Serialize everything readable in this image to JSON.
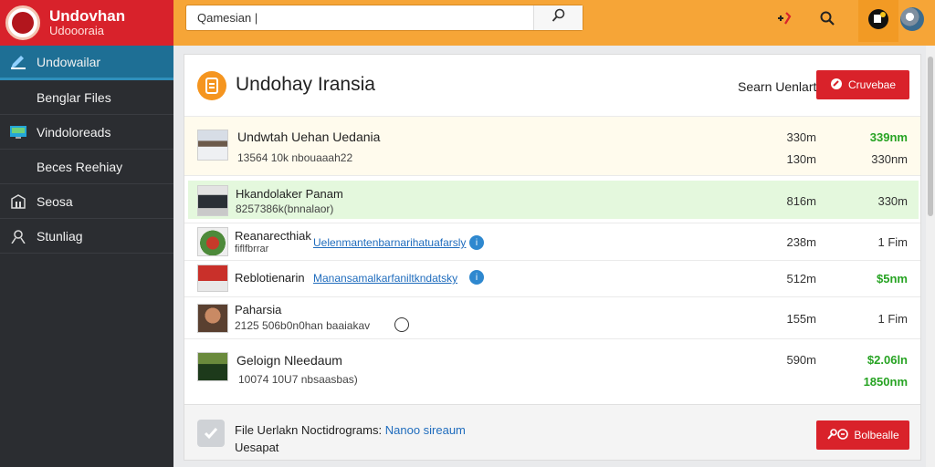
{
  "app": {
    "title": "Undovhan",
    "subtitle": "Udoooraia"
  },
  "sidebar": {
    "items": [
      {
        "label": "Undowailar",
        "icon": "edit-icon",
        "active": true
      },
      {
        "label": "Benglar Files",
        "icon": "",
        "active": false
      },
      {
        "label": "Vindoloreads",
        "icon": "monitor-icon",
        "active": false
      },
      {
        "label": "Beces Reehiay",
        "icon": "",
        "active": false
      },
      {
        "label": "Seosa",
        "icon": "building-icon",
        "active": false
      },
      {
        "label": "Stunliag",
        "icon": "user-icon",
        "active": false
      }
    ]
  },
  "topbar": {
    "search_value": "Qamesian |"
  },
  "header": {
    "title": "Undohay Iransia",
    "link": "Searn Uenlart",
    "button": "Cruvebae"
  },
  "rows": [
    {
      "title": "Undwtah Uehan Uedania",
      "sub": "13564 10k nbouaaah22",
      "col1_top": "330m",
      "col1_bot": "130m",
      "col2_top": "339nm",
      "col2_bot": "330nm"
    },
    {
      "title": "Hkandolaker Panam",
      "sub": "8257386k(bnnalaor)",
      "col1": "816m",
      "col2": "330m"
    },
    {
      "title": "Reanarecthiak",
      "sub": "fiflfbrrar",
      "link": "Uelenmantenbarnarihatuafarsly",
      "col1": "238m",
      "col2": "1 Fim"
    },
    {
      "title": "Reblotienarin",
      "link": "Manansamalkarfaniltkndatsky",
      "col1": "512m",
      "col2": "$5nm"
    },
    {
      "title": "Paharsia",
      "sub": "2125 506b0n0han baaiakav",
      "col1": "155m",
      "col2": "1 Fim"
    },
    {
      "title": "Geloign Nleedaum",
      "sub": "10074 10U7 nbsaasbas)",
      "col1": "590m",
      "col2_top": "$2.06ln",
      "col2_bot": "1850nm"
    }
  ],
  "footer": {
    "text": "File Uerlakn Noctidrograms:",
    "link": "Nanoo sireaum",
    "sub": "Uesapat",
    "button": "Bolbealle"
  },
  "colors": {
    "brand_red": "#d8222b",
    "topbar_orange": "#f6a537",
    "sidebar_dark": "#2b2d31",
    "active_blue": "#1e6f95",
    "positive_green": "#27a323",
    "button_red": "#d9222a"
  }
}
